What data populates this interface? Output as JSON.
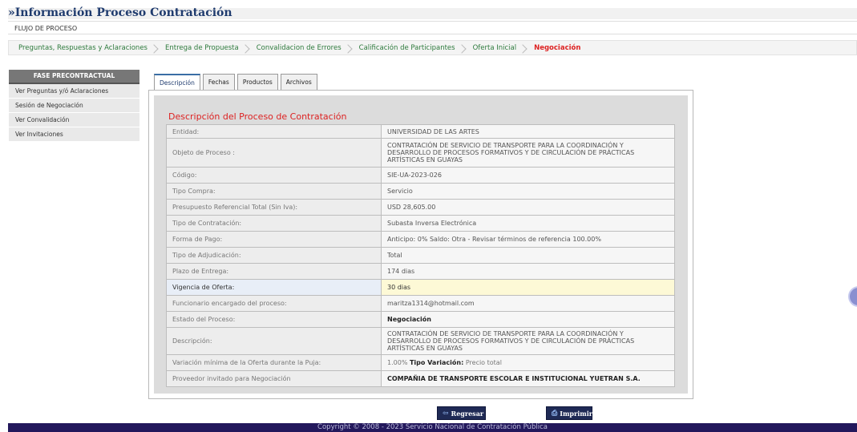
{
  "page": {
    "title": "»Información Proceso Contratación",
    "flow_label": "FLUJO DE PROCESO"
  },
  "breadcrumb": [
    {
      "label": "Preguntas, Respuestas y Aclaraciones"
    },
    {
      "label": "Entrega de Propuesta"
    },
    {
      "label": "Convalidacion de Errores"
    },
    {
      "label": "Calificación de Participantes"
    },
    {
      "label": "Oferta Inicial"
    },
    {
      "label": "Negociación",
      "active": true
    }
  ],
  "sidebar": {
    "header": "FASE PRECONTRACTUAL",
    "items": [
      {
        "label": "Ver Preguntas y/ó Aclaraciones"
      },
      {
        "label": "Sesión de Negociación"
      },
      {
        "label": "Ver Convalidación"
      },
      {
        "label": "Ver Invitaciones"
      }
    ]
  },
  "tabs": [
    {
      "label": "Descripción",
      "active": true
    },
    {
      "label": "Fechas"
    },
    {
      "label": "Productos"
    },
    {
      "label": "Archivos"
    }
  ],
  "section_title": "Descripción del Proceso de Contratación",
  "rows": [
    {
      "label": "Entidad:",
      "value": "UNIVERSIDAD DE LAS ARTES"
    },
    {
      "label": "Objeto de Proceso :",
      "value": "CONTRATACIÓN DE SERVICIO DE TRANSPORTE PARA LA COORDINACIÓN Y DESARROLLO DE PROCESOS FORMATIVOS Y DE CIRCULACIÓN DE PRÁCTICAS ARTÍSTICAS EN GUAYAS"
    },
    {
      "label": "Código:",
      "value": "SIE-UA-2023-026"
    },
    {
      "label": "Tipo Compra:",
      "value": "Servicio"
    },
    {
      "label": "Presupuesto Referencial Total (Sin Iva):",
      "value": "USD 28,605.00"
    },
    {
      "label": "Tipo de Contratación:",
      "value": "Subasta Inversa Electrónica"
    },
    {
      "label": "Forma de Pago:",
      "value": "Anticipo: 0% Saldo: Otra - Revisar términos de referencia 100.00%"
    },
    {
      "label": "Tipo de Adjudicación:",
      "value": "Total"
    },
    {
      "label": "Plazo de Entrega:",
      "value": "174 dias"
    },
    {
      "label": "Vigencia de Oferta:",
      "value": "30 dias",
      "highlight": true
    },
    {
      "label": "Funcionario encargado del proceso:",
      "value": "maritza1314@hotmail.com"
    },
    {
      "label": "Estado del Proceso:",
      "value": "Negociación",
      "bold": true
    },
    {
      "label": "Descripción:",
      "value": "CONTRATACIÓN DE SERVICIO DE TRANSPORTE PARA LA COORDINACIÓN Y DESARROLLO DE PROCESOS FORMATIVOS Y DE CIRCULACIÓN DE PRÁCTICAS ARTÍSTICAS EN GUAYAS"
    },
    {
      "label": "Variación mínima de la Oferta durante la Puja:",
      "value": "1.00%",
      "extra_label": "Tipo Variación:",
      "extra_value": "Precio total"
    },
    {
      "label": "Proveedor invitado para Negociación",
      "value": "COMPAÑIA DE TRANSPORTE ESCOLAR E INSTITUCIONAL YUETRAN S.A.",
      "bold": true
    }
  ],
  "buttons": {
    "back": "Regresar",
    "print": "Imprimir"
  },
  "footer": "Copyright © 2008 - 2023 Servicio Nacional de Contratación Pública",
  "icons": {
    "back": "arrow-left-icon",
    "print": "printer-icon"
  }
}
